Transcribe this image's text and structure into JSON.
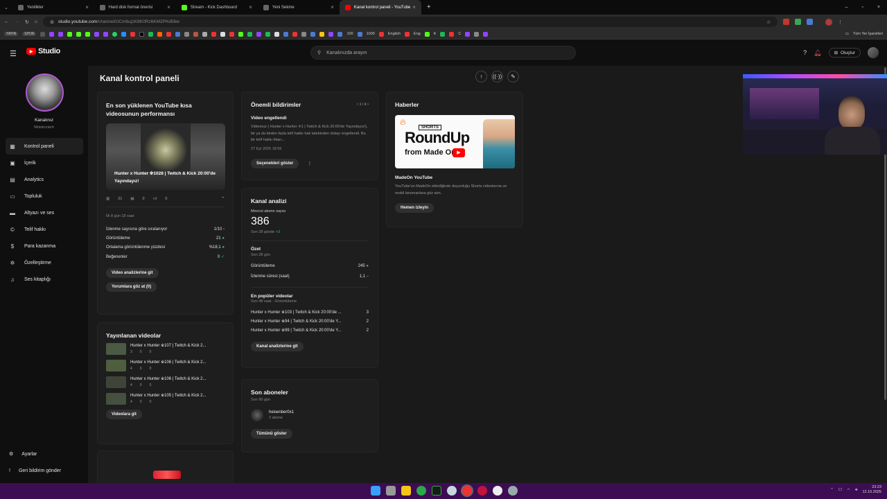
{
  "browser": {
    "tabs": [
      {
        "label": "Yenilikler",
        "color": "#888888"
      },
      {
        "label": "Hard disk format önerisi",
        "color": "#888888"
      },
      {
        "label": "Stream - Kick Dashboard",
        "color": "#53fc18"
      },
      {
        "label": "Yeni Sekme",
        "color": "#888888"
      },
      {
        "label": "Kanal kontrol paneli - YouTube",
        "color": "#ff0000"
      }
    ],
    "url_main": "studio.youtube.com",
    "url_rest": "/channel/UCm6uj1K8K0Rz6KM2PKd56w",
    "bookmarks": [
      "YAYIN",
      "SPOR",
      "100",
      "1000",
      "English",
      "Eng",
      "K",
      "C"
    ],
    "all_bookmarks": "Tüm Yer İşaretleri"
  },
  "studio": {
    "logo_text": "Studio",
    "search_placeholder": "Kanalınızda arayın",
    "create_label": "Oluştur",
    "channel_name": "Kanalınız",
    "channel_sub": "Mnistrıcterti",
    "nav": [
      "Kontrol paneli",
      "İçerik",
      "Analytics",
      "Topluluk",
      "Altyazı ve ses",
      "Telif hakkı",
      "Para kazanma",
      "Özelleştirme",
      "Ses kitaplığı"
    ],
    "nav_bottom": [
      "Ayarlar",
      "Geri bildirim gönder"
    ],
    "page_title": "Kanal kontrol paneli"
  },
  "latest_short": {
    "title": "En son yüklenen YouTube kısa videosunun performansı",
    "video_title": "Hunter x Hunter ※1028 | Twitch & Kick 20:00'de Yayındayız!",
    "views": "21",
    "comments": "0",
    "likes": "0",
    "age": "İlk 8 gün 18 saat",
    "rows": [
      {
        "label": "İzlenme sayısına göre sıralanıyor",
        "value": "1/10"
      },
      {
        "label": "Görüntüleme",
        "value": "21"
      },
      {
        "label": "Ortalama görüntülenme yüzdesi",
        "value": "%18,1"
      },
      {
        "label": "Beğenenler",
        "value": "0"
      }
    ],
    "btn_analytics": "Video analizlerine git",
    "btn_comments": "Yorumlara göz at (0)"
  },
  "published": {
    "title": "Yayınlanan videolar",
    "items": [
      {
        "title": "Hunter x Hunter ※107 | Twitch & Kick 2...",
        "views": "3",
        "comments": "0",
        "likes": "0"
      },
      {
        "title": "Hunter x Hunter ※106 | Twitch & Kick 2...",
        "views": "4",
        "comments": "0",
        "likes": "0"
      },
      {
        "title": "Hunter x Hunter ※106 | Twitch & Kick 2...",
        "views": "4",
        "comments": "0",
        "likes": "0"
      },
      {
        "title": "Hunter x Hunter ※105 | Twitch & Kick 2...",
        "views": "4",
        "comments": "0",
        "likes": "0"
      }
    ],
    "btn": "Videolara git"
  },
  "notifications": {
    "title": "Önemli bildirimler",
    "pager": "1 / 4",
    "heading": "Video engellendi",
    "body": "Videonuz ( Hunter x Hunter ※1 | Twitch & Kick 20:00'de Yayındayız!), bir ya da birden fazla telif hakkı hak talebinden dolayı engellendi. Bu bir telif hakkı ihtarı...",
    "date": "27 Eyl 2025 18:59",
    "btn": "Seçenekleri göster"
  },
  "analytics": {
    "title": "Kanal analizi",
    "subs_label": "Mevcut abone sayısı",
    "subs": "386",
    "subs_change_label": "Son 28 günde",
    "subs_change": "+3",
    "summary": "Özet",
    "summary_period": "Son 28 gün",
    "rows": [
      {
        "label": "Görüntüleme",
        "value": "245"
      },
      {
        "label": "İzlenme süresi (saat)",
        "value": "1,1"
      }
    ],
    "top_title": "En popüler videolar",
    "top_sub": "Son 48 saat · Görüntüleme",
    "top": [
      {
        "title": "Hunter x Hunter ※103 | Twitch & Kick 20:00'de ...",
        "value": "3"
      },
      {
        "title": "Hunter x Hunter ※94 | Twitch & Kick 20:00'de Y...",
        "value": "2"
      },
      {
        "title": "Hunter x Hunter ※99 | Twitch & Kick 20:00'de Y...",
        "value": "2"
      }
    ],
    "btn": "Kanal analizlerine git"
  },
  "subscribers": {
    "title": "Son aboneler",
    "period": "Son 90 gün",
    "name": "heisenber0x1",
    "count": "2 abone",
    "btn": "Tümünü göster"
  },
  "news": {
    "title": "Haberler",
    "banner_tag": "SHORTS",
    "banner_big": "RoundUp",
    "banner_from": "from Made On",
    "heading": "MadeOn YouTube",
    "body": "YouTube'un MadeOn etkinliğinde duyurduğu Shorts videolarına ve mobil lansmanlara göz atın.",
    "btn": "Hemen izleyin"
  },
  "taskbar": {
    "time": "23:23",
    "date": "12.10.2025"
  }
}
